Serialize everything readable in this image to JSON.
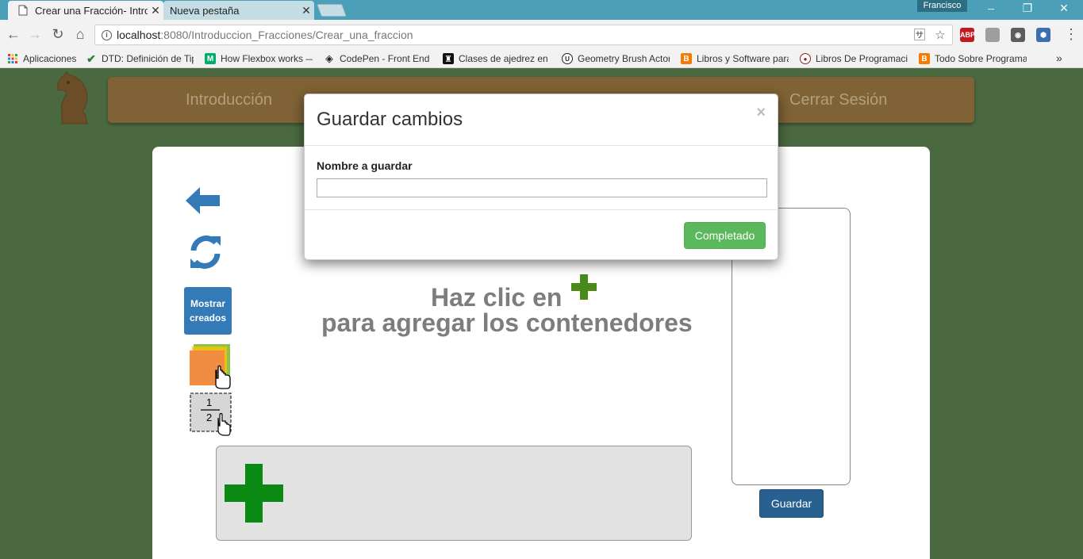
{
  "browser": {
    "tabs": [
      {
        "title": "Crear una Fracción- Intro",
        "active": true
      },
      {
        "title": "Nueva pestaña",
        "active": false
      }
    ],
    "profile": "Francisco",
    "window_controls": {
      "minimize": "–",
      "restore": "❐",
      "close": "✕"
    },
    "url_host": "localhost",
    "url_rest": ":8080/Introduccion_Fracciones/Crear_una_fraccion",
    "extensions": [
      {
        "name": "adblock-icon",
        "label": "ABP",
        "color": "#c2181e"
      },
      {
        "name": "extension-icon",
        "label": "",
        "color": "#9e9e9e"
      },
      {
        "name": "bulb-icon",
        "label": "",
        "color": "#5d5d5d"
      },
      {
        "name": "shield-icon",
        "label": "",
        "color": "#3d6fb0"
      }
    ],
    "menu_icon": "⋮",
    "bookmarks": [
      {
        "label": "Aplicaciones",
        "icon": "apps-icon",
        "color": "#e53935"
      },
      {
        "label": "DTD: Definición de Tip",
        "icon": "checkmark-icon",
        "color": "#2e7d32"
      },
      {
        "label": "How Flexbox works —",
        "icon": "medium-icon",
        "color": "#00ab6c"
      },
      {
        "label": "CodePen - Front End",
        "icon": "codepen-icon",
        "color": "#222222"
      },
      {
        "label": "Clases de ajedrez en v",
        "icon": "chess-icon",
        "color": "#111111"
      },
      {
        "label": "Geometry Brush Actor",
        "icon": "unreal-icon",
        "color": "#222222"
      },
      {
        "label": "Libros y Software para",
        "icon": "blogger-icon",
        "color": "#f57c00"
      },
      {
        "label": "Libros De Programació",
        "icon": "globe-icon",
        "color": "#8e2424"
      },
      {
        "label": "Todo Sobre Programa",
        "icon": "blogger-icon",
        "color": "#f57c00"
      }
    ],
    "bookmarks_more": "»"
  },
  "nav": {
    "links": [
      "Introducción",
      "Cerrar Sesión"
    ]
  },
  "tools": {
    "mostrar_label": "Mostrar creados",
    "fraction_numerator": "1",
    "fraction_denominator": "2"
  },
  "hint": {
    "line1": "Haz clic en",
    "line2": "para agregar los contenedores"
  },
  "panel": {
    "save_button": "Guardar"
  },
  "modal": {
    "title": "Guardar cambios",
    "close": "×",
    "field_label": "Nombre a guardar",
    "field_value": "",
    "confirm_button": "Completado"
  },
  "colors": {
    "page_bg": "#4a6941",
    "navbar": "#7f6235",
    "primary": "#337ab7",
    "success": "#5cb85c",
    "plus_green": "#0a8a12"
  }
}
